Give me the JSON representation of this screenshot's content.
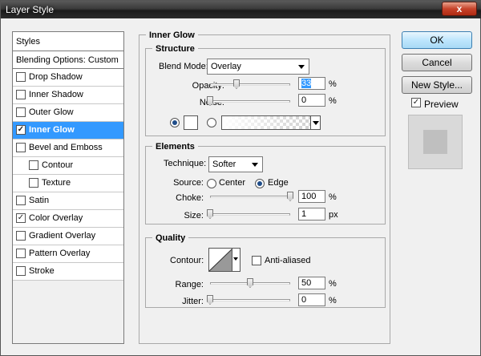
{
  "window": {
    "title": "Layer Style",
    "close": "x"
  },
  "styles_panel": {
    "header": "Styles",
    "blending_options": "Blending Options: Custom",
    "items": [
      {
        "label": "Drop Shadow",
        "checked": false,
        "selected": false,
        "level": 0
      },
      {
        "label": "Inner Shadow",
        "checked": false,
        "selected": false,
        "level": 0
      },
      {
        "label": "Outer Glow",
        "checked": false,
        "selected": false,
        "level": 0
      },
      {
        "label": "Inner Glow",
        "checked": true,
        "selected": true,
        "level": 0
      },
      {
        "label": "Bevel and Emboss",
        "checked": false,
        "selected": false,
        "level": 0
      },
      {
        "label": "Contour",
        "checked": false,
        "selected": false,
        "level": 1
      },
      {
        "label": "Texture",
        "checked": false,
        "selected": false,
        "level": 1
      },
      {
        "label": "Satin",
        "checked": false,
        "selected": false,
        "level": 0
      },
      {
        "label": "Color Overlay",
        "checked": true,
        "selected": false,
        "level": 0
      },
      {
        "label": "Gradient Overlay",
        "checked": false,
        "selected": false,
        "level": 0
      },
      {
        "label": "Pattern Overlay",
        "checked": false,
        "selected": false,
        "level": 0
      },
      {
        "label": "Stroke",
        "checked": false,
        "selected": false,
        "level": 0
      }
    ]
  },
  "inner_glow": {
    "title": "Inner Glow",
    "structure": {
      "title": "Structure",
      "blend_mode_label": "Blend Mode:",
      "blend_mode_value": "Overlay",
      "opacity_label": "Opacity:",
      "opacity_value": "33",
      "opacity_unit": "%",
      "opacity_level": 0.33,
      "noise_label": "Noise:",
      "noise_value": "0",
      "noise_unit": "%",
      "noise_level": 0.0,
      "color_mode": "solid"
    },
    "elements": {
      "title": "Elements",
      "technique_label": "Technique:",
      "technique_value": "Softer",
      "source_label": "Source:",
      "source_center": "Center",
      "source_edge": "Edge",
      "source_selected": "edge",
      "choke_label": "Choke:",
      "choke_value": "100",
      "choke_unit": "%",
      "choke_level": 1.0,
      "size_label": "Size:",
      "size_value": "1",
      "size_unit": "px",
      "size_level": 0.0
    },
    "quality": {
      "title": "Quality",
      "contour_label": "Contour:",
      "anti_aliased_label": "Anti-aliased",
      "anti_aliased_checked": false,
      "range_label": "Range:",
      "range_value": "50",
      "range_unit": "%",
      "range_level": 0.5,
      "jitter_label": "Jitter:",
      "jitter_value": "0",
      "jitter_unit": "%",
      "jitter_level": 0.0
    }
  },
  "buttons": {
    "ok": "OK",
    "cancel": "Cancel",
    "new_style": "New Style..."
  },
  "preview": {
    "label": "Preview",
    "checked": true
  }
}
